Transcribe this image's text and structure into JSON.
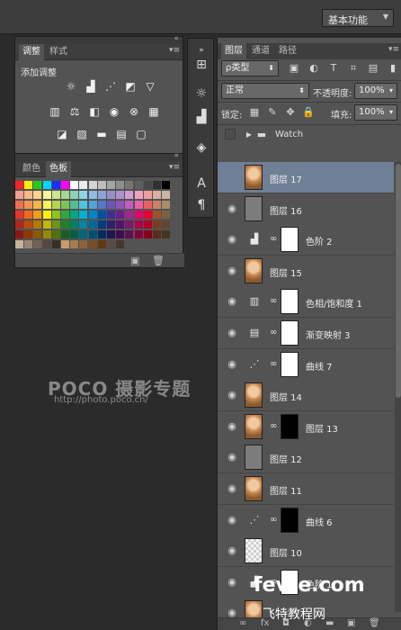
{
  "topbar": {
    "workspace": "基本功能"
  },
  "adjust_panel": {
    "tabs": [
      "调整",
      "样式"
    ],
    "title": "添加调整",
    "row1": [
      {
        "icon": "brightness-contrast-icon",
        "glyph": "☼"
      },
      {
        "icon": "levels-icon",
        "glyph": "▟"
      },
      {
        "icon": "curves-icon",
        "glyph": "⋰"
      },
      {
        "icon": "exposure-icon",
        "glyph": "◩"
      },
      {
        "icon": "vibrance-icon",
        "glyph": "▽"
      }
    ],
    "row2": [
      {
        "icon": "hue-saturation-icon",
        "glyph": "▥"
      },
      {
        "icon": "color-balance-icon",
        "glyph": "⚖"
      },
      {
        "icon": "black-white-icon",
        "glyph": "◧"
      },
      {
        "icon": "photo-filter-icon",
        "glyph": "◉"
      },
      {
        "icon": "channel-mixer-icon",
        "glyph": "⊗"
      },
      {
        "icon": "color-lookup-icon",
        "glyph": "▦"
      }
    ],
    "row3": [
      {
        "icon": "invert-icon",
        "glyph": "◪"
      },
      {
        "icon": "posterize-icon",
        "glyph": "▨"
      },
      {
        "icon": "threshold-icon",
        "glyph": "▬"
      },
      {
        "icon": "gradient-map-icon",
        "glyph": "▤"
      },
      {
        "icon": "selective-color-icon",
        "glyph": "▢"
      }
    ]
  },
  "swatches_panel": {
    "tabs": [
      "颜色",
      "色板"
    ],
    "rows": [
      [
        "#ff2020",
        "#ffee00",
        "#22cc22",
        "#00d6ff",
        "#1a2fff",
        "#ff00ff",
        "#ffffff",
        "#ececec",
        "#d4d4d4",
        "#bdbdbd",
        "#a5a5a5",
        "#8e8e8e",
        "#767676",
        "#5e5e5e",
        "#474747",
        "#303030",
        "#000000"
      ],
      [
        "#f5a08f",
        "#f7b98a",
        "#fad289",
        "#fff59a",
        "#cde58f",
        "#a3d88f",
        "#8ed2b3",
        "#8dd5e5",
        "#8fbbe6",
        "#8fa3d8",
        "#988fcc",
        "#b08fcc",
        "#d39bd4",
        "#f29dc4",
        "#f09d9d",
        "#dbaea0",
        "#c9b7a0"
      ],
      [
        "#ef6f56",
        "#f39551",
        "#f7b74c",
        "#fff35d",
        "#b5d655",
        "#7bc456",
        "#55bd93",
        "#4fc4dc",
        "#54a1db",
        "#5678c8",
        "#6a56b7",
        "#8f56b7",
        "#c25dc1",
        "#ed5fa6",
        "#ec5f61",
        "#c98264",
        "#a68e6a"
      ],
      [
        "#e8332a",
        "#ef6a1d",
        "#f59c14",
        "#fff000",
        "#8fc31f",
        "#33a83a",
        "#00a77d",
        "#00b0d6",
        "#0086cb",
        "#0051a3",
        "#3f2d90",
        "#6a1f8d",
        "#a1268c",
        "#e5006a",
        "#e60033",
        "#a0522d",
        "#7d6040"
      ],
      [
        "#b6231a",
        "#b94d0c",
        "#bd7606",
        "#c2b700",
        "#6d9616",
        "#1f8229",
        "#00815f",
        "#0087a4",
        "#00669c",
        "#003d7c",
        "#2f1f6e",
        "#50146b",
        "#7b196a",
        "#af0050",
        "#b00025",
        "#7a3c20",
        "#5e4730"
      ],
      [
        "#8a1710",
        "#8c3807",
        "#905803",
        "#948b00",
        "#52710f",
        "#14611d",
        "#006146",
        "#00667b",
        "#004d76",
        "#002d5e",
        "#221552",
        "#3c0e51",
        "#5c1150",
        "#84003c",
        "#85001b",
        "#5b2c17",
        "#463423"
      ],
      [
        "#c7b299",
        "#998675",
        "#736357",
        "#534741",
        "#37302d",
        "#c69c6d",
        "#a67c52",
        "#8c6239",
        "#754c24",
        "#603913",
        "#5a4a3f",
        "#44382f"
      ]
    ]
  },
  "watermark": {
    "poco_logo": "POCO 摄影专题",
    "poco_url": "http://photo.poco.cn/",
    "site": "fevte.com",
    "site_cn": "飞特教程网"
  },
  "layers_panel": {
    "tabs": [
      "图层",
      "通道",
      "路径"
    ],
    "filter_kind": "ρ类型",
    "blend_mode": "正常",
    "opacity_label": "不透明度:",
    "opacity_value": "100%",
    "lock_label": "锁定:",
    "fill_label": "填充:",
    "fill_value": "100%",
    "group": "Watch",
    "layers": [
      {
        "name": "图层 17",
        "type": "portrait",
        "active": true,
        "visible": false
      },
      {
        "name": "图层 16",
        "type": "gray",
        "visible": true
      },
      {
        "name": "色阶 2",
        "type": "adjust",
        "glyph": "▟",
        "mask": "white",
        "visible": true
      },
      {
        "name": "图层 15",
        "type": "portrait",
        "visible": true
      },
      {
        "name": "色相/饱和度 1",
        "type": "adjust",
        "glyph": "▥",
        "mask": "white",
        "visible": true
      },
      {
        "name": "渐变映射 3",
        "type": "adjust",
        "glyph": "▤",
        "mask": "white",
        "visible": true
      },
      {
        "name": "曲线 7",
        "type": "adjust",
        "glyph": "⋰",
        "mask": "white",
        "visible": true
      },
      {
        "name": "图层 14",
        "type": "portrait",
        "visible": true
      },
      {
        "name": "图层 13",
        "type": "portrait",
        "mask": "black",
        "visible": true
      },
      {
        "name": "图层 12",
        "type": "gray",
        "visible": true
      },
      {
        "name": "图层 11",
        "type": "portrait",
        "visible": true
      },
      {
        "name": "曲线 6",
        "type": "adjust",
        "glyph": "⋰",
        "mask": "black",
        "visible": true
      },
      {
        "name": "图层 10",
        "type": "checker",
        "visible": true
      },
      {
        "name": "色阶 1",
        "type": "adjust",
        "glyph": "▟",
        "mask": "white",
        "visible": true
      },
      {
        "name": "",
        "type": "portrait",
        "visible": true
      }
    ],
    "footer": [
      "link-icon",
      "fx-icon",
      "mask-icon",
      "adjustment-icon",
      "folder-icon",
      "new-layer-icon",
      "trash-icon"
    ]
  }
}
